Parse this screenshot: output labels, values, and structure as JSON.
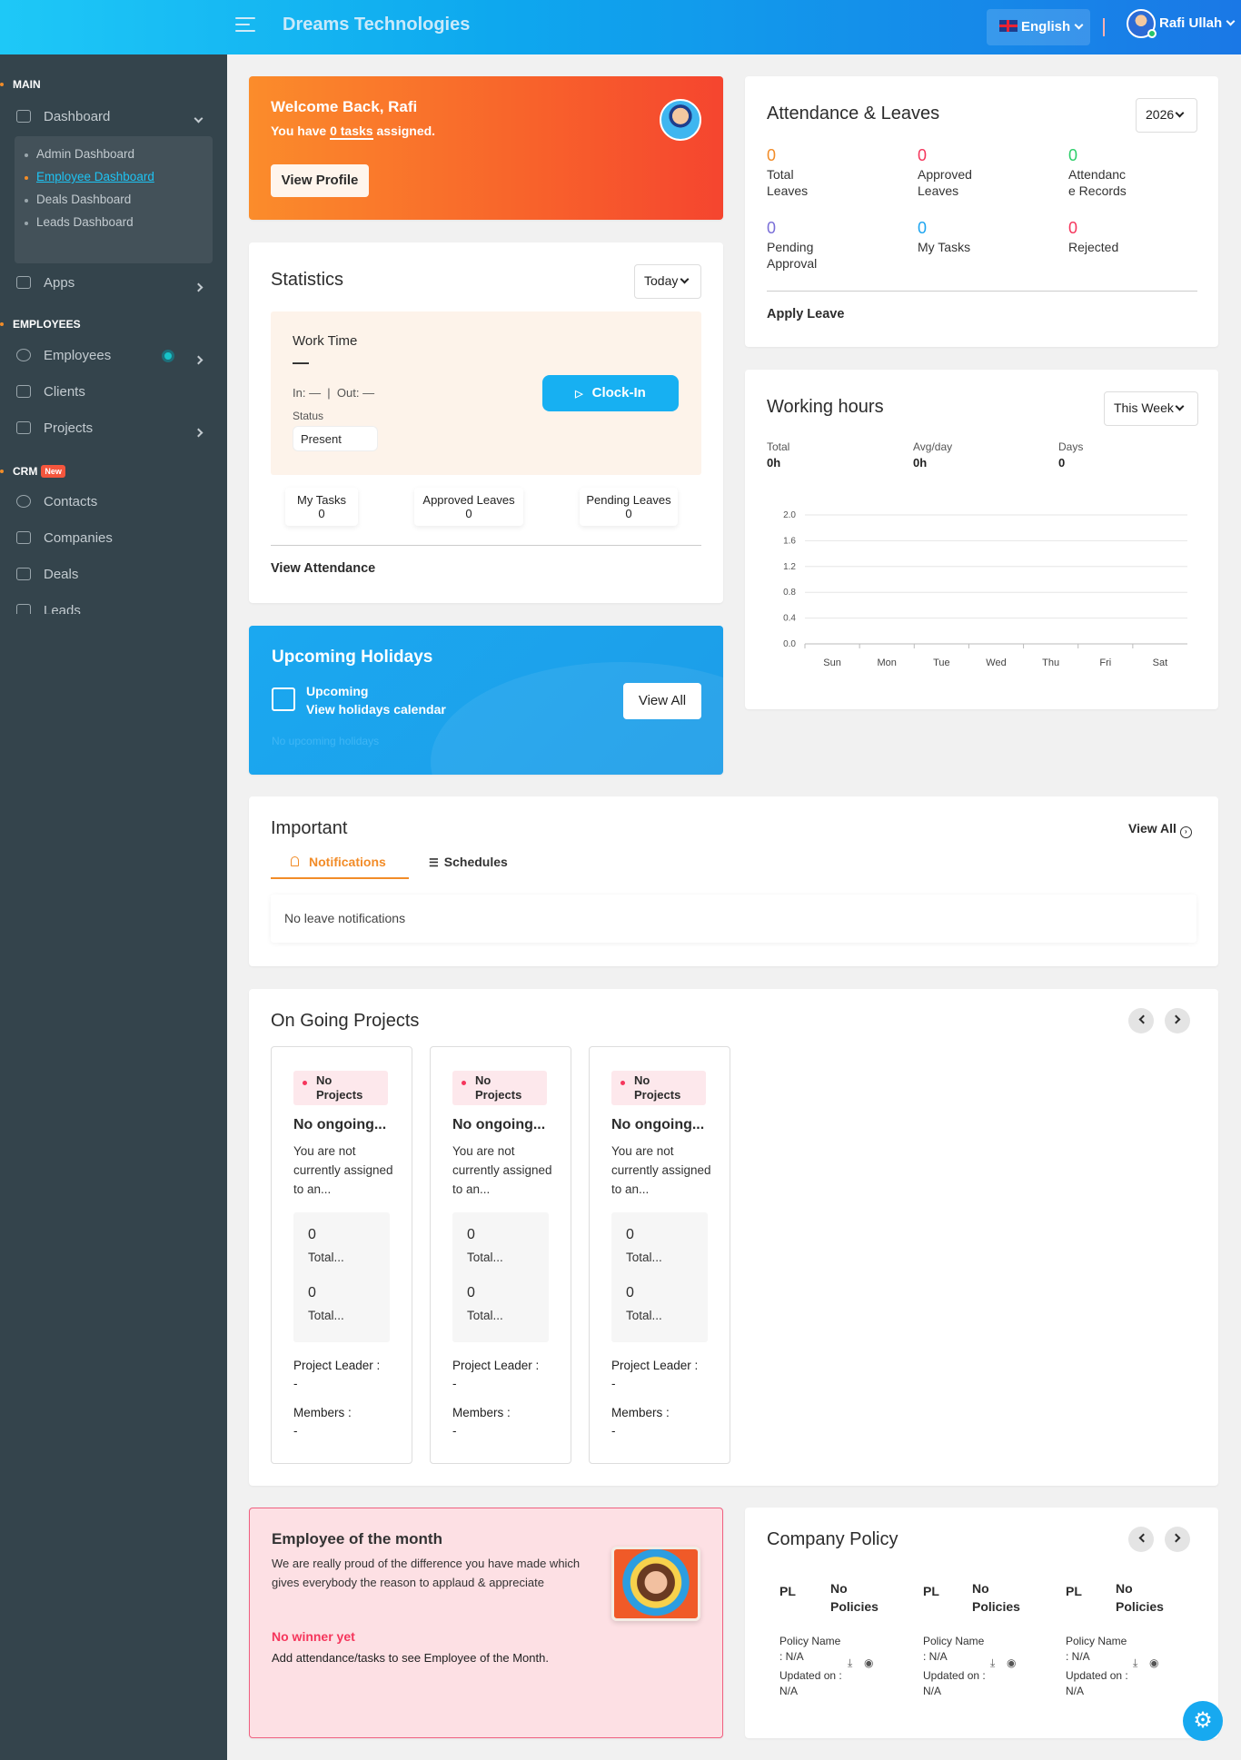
{
  "topbar": {
    "brand": "Dreams Technologies",
    "language": "English",
    "user_name": "Rafi Ullah"
  },
  "sidebar": {
    "main_label": "MAIN",
    "dashboard": "Dashboard",
    "submenu": [
      "Admin Dashboard",
      "Employee Dashboard",
      "Deals Dashboard",
      "Leads Dashboard"
    ],
    "apps": "Apps",
    "employees_label": "EMPLOYEES",
    "employees": "Employees",
    "clients": "Clients",
    "projects": "Projects",
    "crm_label": "CRM",
    "new_badge": "New",
    "contacts": "Contacts",
    "companies": "Companies",
    "deals": "Deals",
    "leads": "Leads"
  },
  "welcome": {
    "title": "Welcome Back, Rafi",
    "text_pre": "You have",
    "tasks": "0 tasks",
    "text_post": "assigned.",
    "button": "View Profile"
  },
  "statistics": {
    "title": "Statistics",
    "filter": "Today",
    "work_time_label": "Work Time",
    "work_time": "—",
    "in_out": "In: —  |  Out: —",
    "status_label": "Status",
    "status_value": "Present",
    "clockin": "Clock-In",
    "mini": [
      {
        "label": "My Tasks",
        "value": "0"
      },
      {
        "label": "Approved Leaves",
        "value": "0"
      },
      {
        "label": "Pending Leaves",
        "value": "0"
      }
    ],
    "link": "View Attendance"
  },
  "holidays": {
    "title": "Upcoming Holidays",
    "sub1": "Upcoming",
    "sub2": "View holidays calendar",
    "button": "View All",
    "empty": "No upcoming holidays"
  },
  "attendance": {
    "title": "Attendance & Leaves",
    "year": "2026",
    "stats": [
      {
        "value": "0",
        "label": "Total\nLeaves",
        "color": "#f28c28"
      },
      {
        "value": "0",
        "label": "Approved\nLeaves",
        "color": "#f5365c"
      },
      {
        "value": "0",
        "label": "Attendanc\ne Records",
        "color": "#2dce6a"
      },
      {
        "value": "0",
        "label": "Pending\nApproval",
        "color": "#7a6fd8"
      },
      {
        "value": "0",
        "label": "My Tasks",
        "color": "#1ea5f0"
      },
      {
        "value": "0",
        "label": "Rejected",
        "color": "#f5365c"
      }
    ],
    "link": "Apply Leave"
  },
  "working_hours": {
    "title": "Working hours",
    "filter": "This Week",
    "summary": [
      {
        "label": "Total",
        "value": "0h"
      },
      {
        "label": "Avg/day",
        "value": "0h"
      },
      {
        "label": "Days",
        "value": "0"
      }
    ],
    "chart_data": {
      "type": "line",
      "categories": [
        "Sun",
        "Mon",
        "Tue",
        "Wed",
        "Thu",
        "Fri",
        "Sat"
      ],
      "series": [
        {
          "values": [
            0,
            0,
            0,
            0,
            0,
            0,
            0
          ]
        }
      ],
      "ylim": [
        0,
        2.0
      ],
      "yticks": [
        "0.0",
        "0.4",
        "0.8",
        "1.2",
        "1.6",
        "2.0"
      ],
      "grid": true
    }
  },
  "important": {
    "title": "Important",
    "view_all": "View All",
    "tabs": [
      "Notifications",
      "Schedules"
    ],
    "empty": "No leave notifications"
  },
  "projects": {
    "title": "On Going Projects",
    "cards": [
      {
        "badge": "No\nProjects",
        "title": "No ongoing...",
        "desc": "You are not currently assigned to an...",
        "v1": "0",
        "t1": "Total...",
        "v2": "0",
        "t2": "Total...",
        "leader_label": "Project Leader :",
        "leader": "-",
        "members_label": "Members :",
        "members": "-"
      },
      {
        "badge": "No\nProjects",
        "title": "No ongoing...",
        "desc": "You are not currently assigned to an...",
        "v1": "0",
        "t1": "Total...",
        "v2": "0",
        "t2": "Total...",
        "leader_label": "Project Leader :",
        "leader": "-",
        "members_label": "Members :",
        "members": "-"
      },
      {
        "badge": "No\nProjects",
        "title": "No ongoing...",
        "desc": "You are not currently assigned to an...",
        "v1": "0",
        "t1": "Total...",
        "v2": "0",
        "t2": "Total...",
        "leader_label": "Project Leader :",
        "leader": "-",
        "members_label": "Members :",
        "members": "-"
      }
    ]
  },
  "eotm": {
    "title": "Employee of the month",
    "text": "We are really proud of the difference you have made which gives everybody the reason to applaud & appreciate",
    "winner": "No winner yet",
    "hint": "Add attendance/tasks to see Employee of the Month."
  },
  "policy": {
    "title": "Company Policy",
    "items": [
      {
        "abbr": "PL",
        "name": "No\nPolicies",
        "pn_label": "Policy Name",
        "pn": ": N/A",
        "up_label": "Updated on :",
        "up": "N/A"
      },
      {
        "abbr": "PL",
        "name": "No\nPolicies",
        "pn_label": "Policy Name",
        "pn": ": N/A",
        "up_label": "Updated on :",
        "up": "N/A"
      },
      {
        "abbr": "PL",
        "name": "No\nPolicies",
        "pn_label": "Policy Name",
        "pn": ": N/A",
        "up_label": "Updated on :",
        "up": "N/A"
      }
    ]
  }
}
